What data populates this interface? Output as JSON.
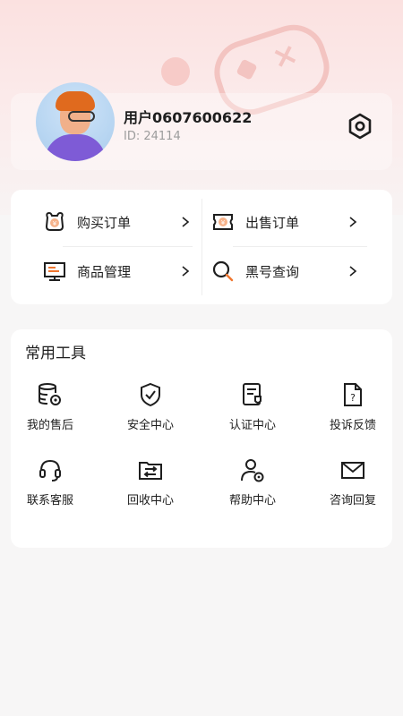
{
  "profile": {
    "username": "用户0607600622",
    "user_id": "ID: 24114"
  },
  "orders": {
    "items": [
      {
        "label": "购买订单",
        "icon": "buy-order-icon"
      },
      {
        "label": "出售订单",
        "icon": "sell-order-icon"
      },
      {
        "label": "商品管理",
        "icon": "monitor-icon"
      },
      {
        "label": "黑号查询",
        "icon": "search-icon"
      }
    ]
  },
  "tools": {
    "title": "常用工具",
    "items": [
      {
        "label": "我的售后",
        "icon": "after-sales-icon"
      },
      {
        "label": "安全中心",
        "icon": "shield-check-icon"
      },
      {
        "label": "认证中心",
        "icon": "certificate-icon"
      },
      {
        "label": "投诉反馈",
        "icon": "document-question-icon"
      },
      {
        "label": "联系客服",
        "icon": "headset-icon"
      },
      {
        "label": "回收中心",
        "icon": "folder-exchange-icon"
      },
      {
        "label": "帮助中心",
        "icon": "user-gear-icon"
      },
      {
        "label": "咨询回复",
        "icon": "mail-icon"
      }
    ]
  },
  "colors": {
    "accent_orange": "#f0762f",
    "text_primary": "#1e1e1e",
    "text_secondary": "#9c9c9c"
  }
}
